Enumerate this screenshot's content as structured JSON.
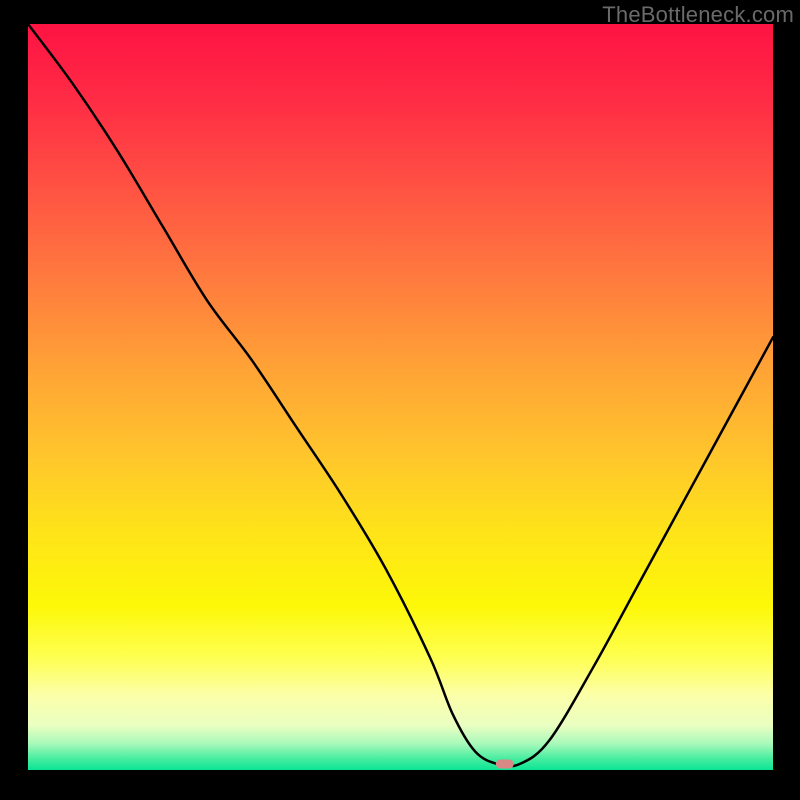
{
  "watermark": "TheBottleneck.com",
  "chart_data": {
    "type": "line",
    "title": "",
    "xlabel": "",
    "ylabel": "",
    "xlim": [
      0,
      100
    ],
    "ylim": [
      0,
      100
    ],
    "grid": false,
    "legend": false,
    "series": [
      {
        "name": "bottleneck-curve",
        "x": [
          0,
          6,
          12,
          18,
          24,
          30,
          36,
          42,
          48,
          54,
          57,
          60,
          63,
          66,
          70,
          76,
          82,
          88,
          94,
          100
        ],
        "y": [
          100,
          92,
          83,
          73,
          63,
          55,
          46,
          37,
          27,
          15,
          7.5,
          2.5,
          0.8,
          0.8,
          4,
          14,
          25,
          36,
          47,
          58
        ]
      }
    ],
    "marker": {
      "x": 64,
      "y": 0.8,
      "color": "#d98985"
    },
    "background_gradient": {
      "stops": [
        {
          "offset": 0.0,
          "color": "#fe1343"
        },
        {
          "offset": 0.1,
          "color": "#ff2b45"
        },
        {
          "offset": 0.22,
          "color": "#ff5243"
        },
        {
          "offset": 0.34,
          "color": "#ff7a3e"
        },
        {
          "offset": 0.46,
          "color": "#ffa236"
        },
        {
          "offset": 0.58,
          "color": "#ffc62c"
        },
        {
          "offset": 0.68,
          "color": "#fee319"
        },
        {
          "offset": 0.78,
          "color": "#fdf808"
        },
        {
          "offset": 0.85,
          "color": "#feff52"
        },
        {
          "offset": 0.9,
          "color": "#fcffa9"
        },
        {
          "offset": 0.94,
          "color": "#eaffc1"
        },
        {
          "offset": 0.965,
          "color": "#a7f9ba"
        },
        {
          "offset": 0.985,
          "color": "#46eda0"
        },
        {
          "offset": 1.0,
          "color": "#0be495"
        }
      ]
    }
  }
}
